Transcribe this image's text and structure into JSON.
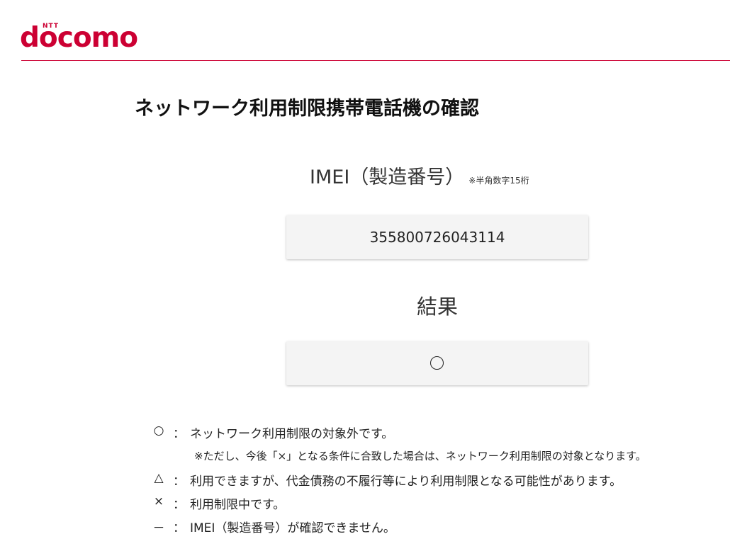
{
  "brand": {
    "small_text": "NTT",
    "logo_text": "docomo",
    "accent_color": "#cc0033"
  },
  "page": {
    "title": "ネットワーク利用制限携帯電話機の確認"
  },
  "imei": {
    "label": "IMEI（製造番号）",
    "note": "※半角数字15桁",
    "value": "355800726043114"
  },
  "result": {
    "label": "結果",
    "symbol": "circle"
  },
  "legend": {
    "items": [
      {
        "symbol": "○",
        "colon": "：",
        "text": "ネットワーク利用制限の対象外です。"
      },
      {
        "note": "※ただし、今後「×」となる条件に合致した場合は、ネットワーク利用制限の対象となります。"
      },
      {
        "symbol": "△",
        "colon": "：",
        "text": "利用できますが、代金債務の不履行等により利用制限となる可能性があります。"
      },
      {
        "symbol": "×",
        "colon": "：",
        "text": "利用制限中です。"
      },
      {
        "symbol": "－",
        "colon": "：",
        "text": "IMEI（製造番号）が確認できません。"
      }
    ]
  }
}
